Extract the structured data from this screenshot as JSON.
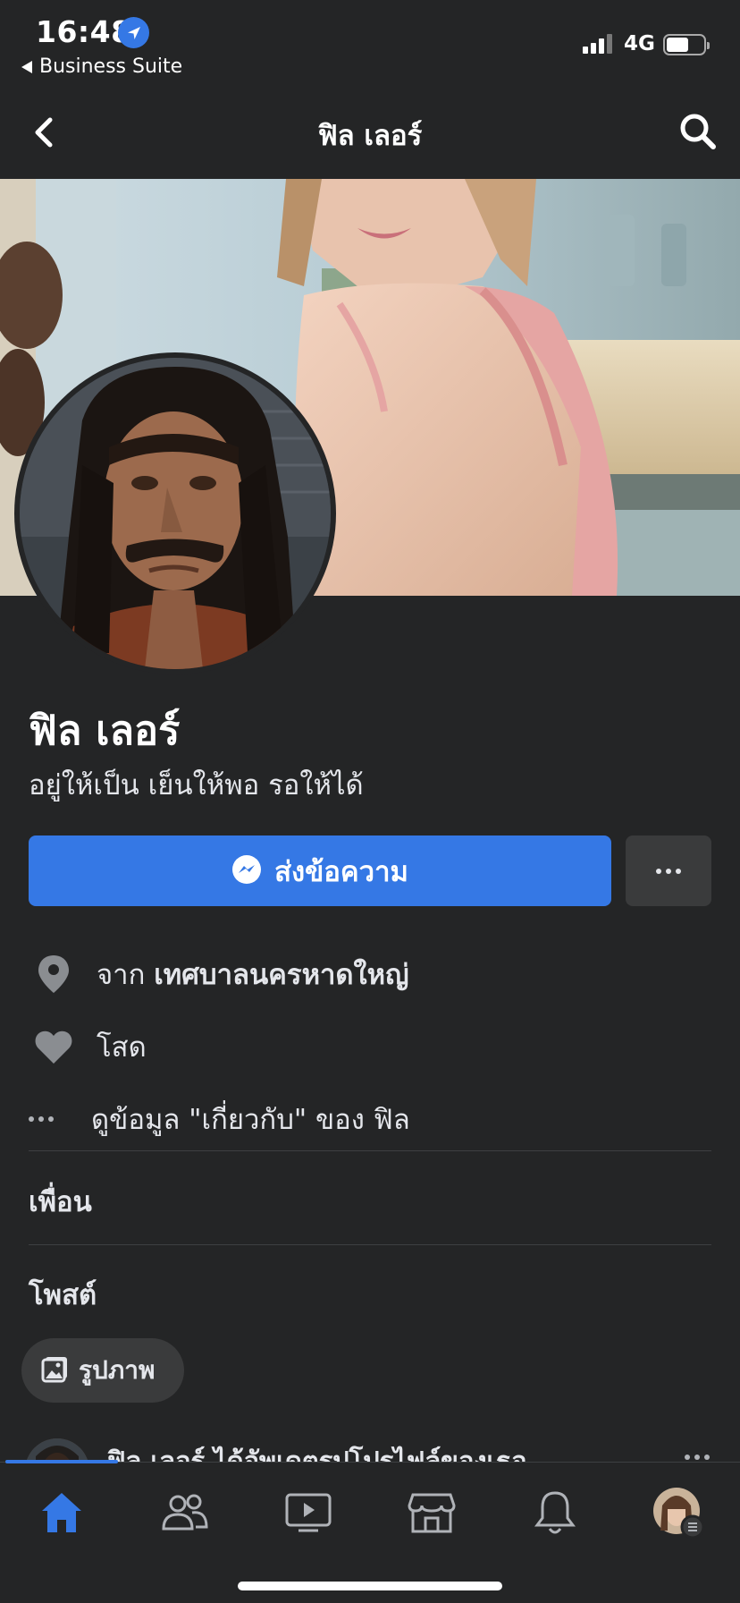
{
  "status_bar": {
    "time": "16:48",
    "back_app_label": "Business Suite",
    "network": "4G",
    "battery_level": 0.6
  },
  "header": {
    "title": "ฟิล เลอร์"
  },
  "profile": {
    "name": "ฟิล เลอร์",
    "bio": "อยู่ให้เป็น เย็นให้พอ รอให้ได้"
  },
  "actions": {
    "message_label": "ส่งข้อความ"
  },
  "details": {
    "location_prefix": "จาก",
    "location_value": "เทศบาลนครหาดใหญ่",
    "relationship": "โสด",
    "about_link": "ดูข้อมูล \"เกี่ยวกับ\" ของ ฟิล"
  },
  "sections": {
    "friends": "เพื่อน",
    "posts": "โพสต์"
  },
  "filters": {
    "photos_label": "รูปภาพ"
  },
  "post_preview": {
    "text": "ฟิล เลอร์ ได้อัพเดตรูปโปรไฟล์ของเธอ"
  },
  "tabbar": {
    "items": [
      "home-icon",
      "friends-icon",
      "watch-icon",
      "marketplace-icon",
      "notifications-icon",
      "profile-menu"
    ],
    "active": "home"
  },
  "colors": {
    "background": "#242526",
    "accent": "#3578e5",
    "surface": "#3a3b3c"
  }
}
